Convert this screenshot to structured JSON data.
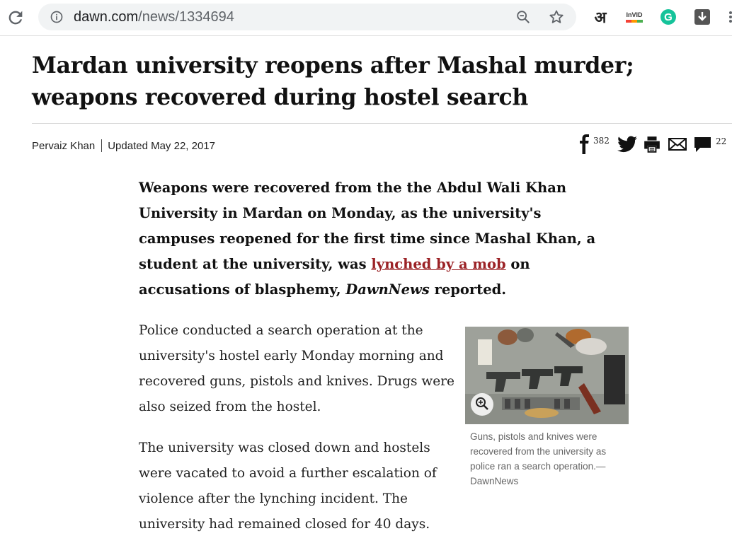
{
  "browser": {
    "url_host": "dawn.com",
    "url_path": "/news/1334694",
    "extensions": [
      {
        "name": "hindi-extension",
        "label": "अ"
      },
      {
        "name": "invid-extension",
        "label": "InVID"
      },
      {
        "name": "grammarly-extension",
        "label": "G"
      },
      {
        "name": "download-extension",
        "label": ""
      }
    ]
  },
  "article": {
    "title": "Mardan university reopens after Mashal murder; weapons recovered during hostel search",
    "author": "Pervaiz Khan",
    "updated": "Updated May 22, 2017",
    "share": {
      "facebook_count": "382",
      "comments_count": "22"
    },
    "lead": {
      "before_link": "Weapons were recovered from the the Abdul Wali Khan University in Mardan on Monday, as the university's campuses reopened for the first time since Mashal Khan, a student at the university, was ",
      "link_text": "lynched by a mob",
      "after_link": " on accusations of blasphemy, ",
      "source": "DawnNews",
      "end": " reported."
    },
    "paragraphs": [
      "Police conducted a search operation at the university's hostel early Monday morning and recovered guns, pistols and knives. Drugs were also seized from the hostel.",
      "The university was closed down and hostels were vacated to avoid a further escalation of violence after the lynching incident. The university had remained closed for 40 days."
    ],
    "image_caption": "Guns, pistols and knives were recovered from the university as police ran a search operation.—DawnNews"
  }
}
